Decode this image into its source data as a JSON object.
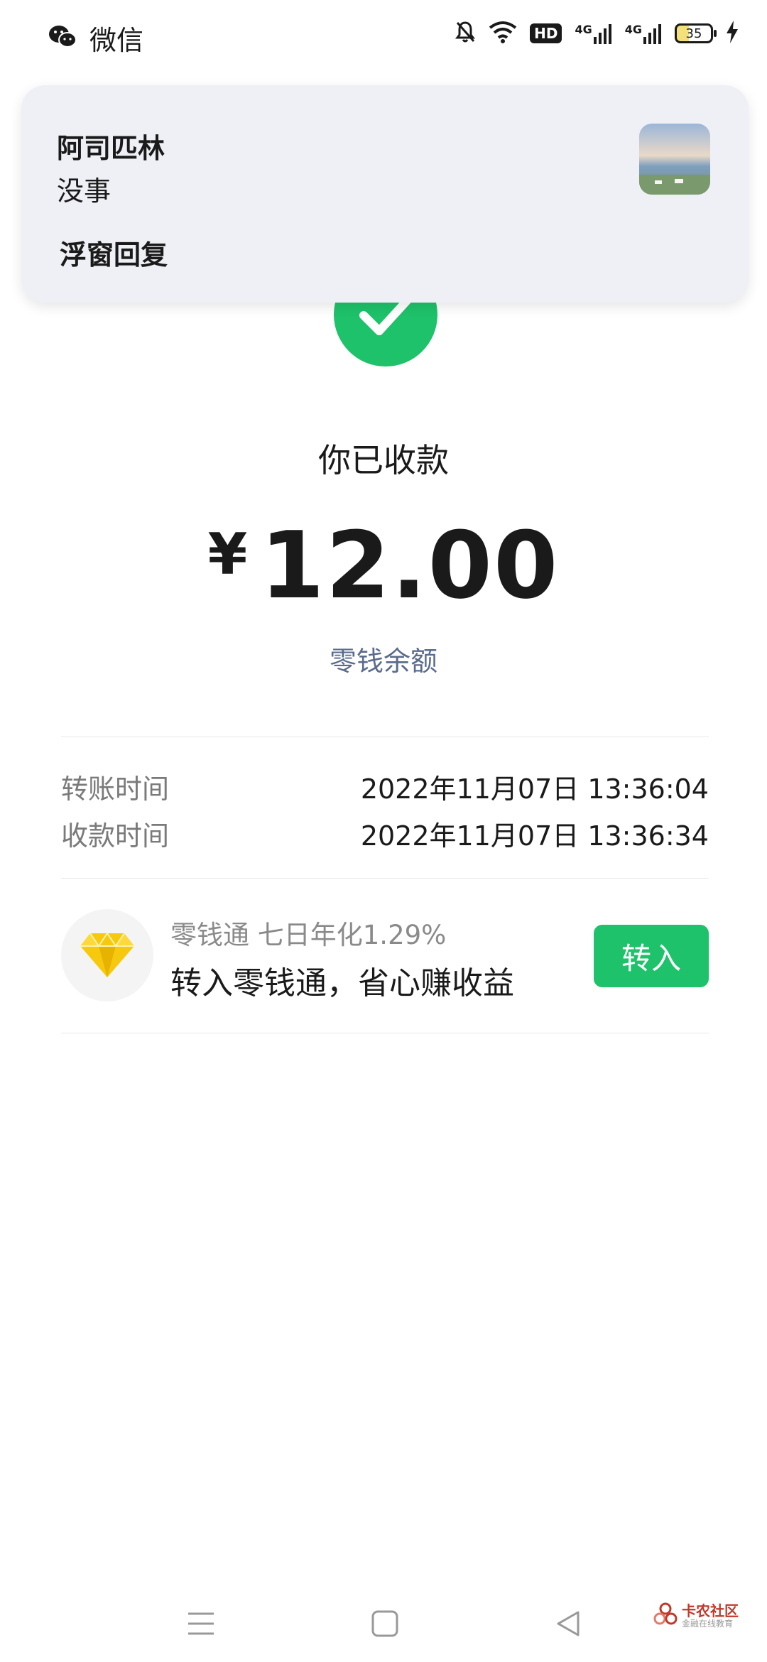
{
  "status_bar": {
    "app_name": "微信",
    "app_icon": "wechat-icon",
    "hd_label": "HD",
    "network_1": "4G",
    "network_2": "4G",
    "battery_level": "35"
  },
  "notification": {
    "sender": "阿司匹林",
    "message": "没事",
    "reply_label": "浮窗回复"
  },
  "receipt": {
    "status_title": "你已收款",
    "currency": "¥",
    "amount": "12.00",
    "balance_link": "零钱余额",
    "accent_color": "#1ec26a"
  },
  "details": [
    {
      "label": "转账时间",
      "value": "2022年11月07日 13:36:04"
    },
    {
      "label": "收款时间",
      "value": "2022年11月07日 13:36:34"
    }
  ],
  "promo": {
    "subtitle": "零钱通 七日年化1.29%",
    "title": "转入零钱通，省心赚收益",
    "button_label": "转入",
    "icon": "diamond-icon"
  },
  "watermark": {
    "title": "卡农社区",
    "subtitle": "金融在线教育"
  }
}
